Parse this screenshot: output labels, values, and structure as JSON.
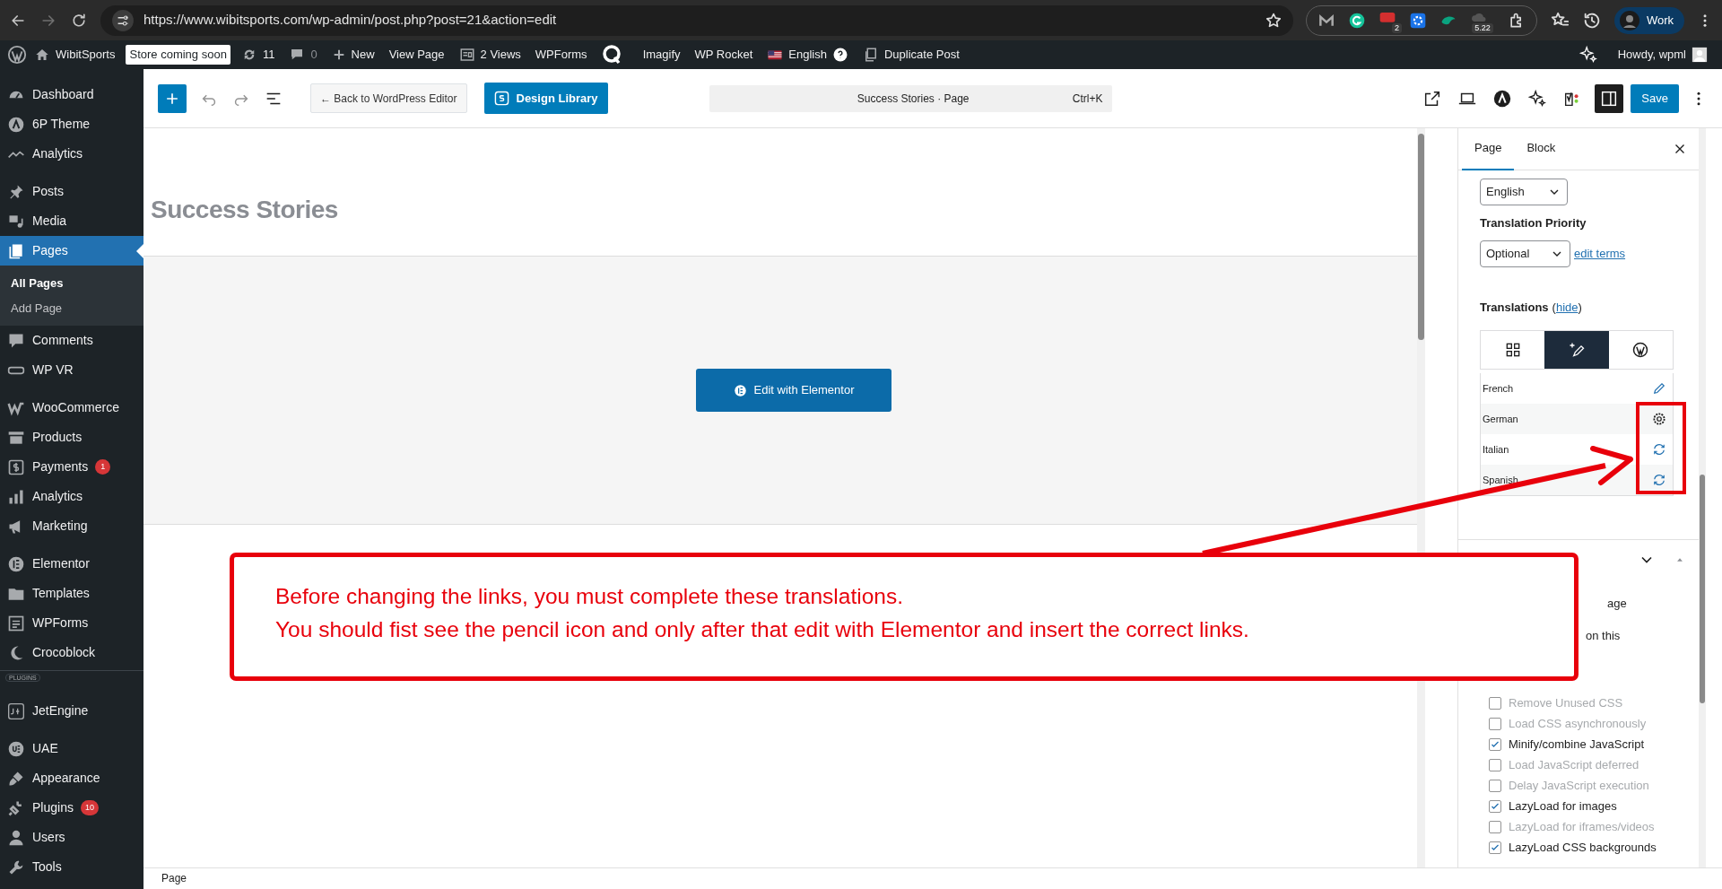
{
  "browser": {
    "url": "https://www.wibitsports.com/wp-admin/post.php?post=21&action=edit",
    "extension_badges": [
      "2",
      "5.22"
    ],
    "profile": "Work"
  },
  "admin_bar": {
    "items": [
      {
        "text": "WibitSports",
        "kind": "link"
      },
      {
        "text": "Store coming soon",
        "kind": "tag"
      },
      {
        "text": "11",
        "kind": "link"
      },
      {
        "text": "0",
        "kind": "dim"
      },
      {
        "text": "New",
        "kind": "link"
      },
      {
        "text": "View Page",
        "kind": "link"
      },
      {
        "text": "2 Views",
        "kind": "link"
      },
      {
        "text": "WPForms",
        "kind": "link"
      },
      {
        "text": "Imagify",
        "kind": "link"
      },
      {
        "text": "WP Rocket",
        "kind": "link"
      },
      {
        "text": "English",
        "kind": "link"
      },
      {
        "text": "Duplicate Post",
        "kind": "link"
      }
    ],
    "greeting": "Howdy, wpml"
  },
  "sidebar": {
    "groups": [
      {
        "items": [
          {
            "label": "Dashboard",
            "selected": false
          },
          {
            "label": "6P Theme",
            "selected": false
          },
          {
            "label": "Analytics",
            "selected": false
          }
        ]
      },
      {
        "items": [
          {
            "label": "Posts",
            "selected": false
          },
          {
            "label": "Media",
            "selected": false
          },
          {
            "label": "Pages",
            "selected": true,
            "children": [
              {
                "label": "All Pages",
                "selected": true
              },
              {
                "label": "Add Page",
                "selected": false
              }
            ]
          },
          {
            "label": "Comments",
            "selected": false
          },
          {
            "label": "WP VR",
            "selected": false
          }
        ]
      },
      {
        "items": [
          {
            "label": "WooCommerce",
            "selected": false
          },
          {
            "label": "Products",
            "selected": false
          },
          {
            "label": "Payments",
            "selected": false,
            "badge": "1"
          },
          {
            "label": "Analytics",
            "selected": false
          },
          {
            "label": "Marketing",
            "selected": false
          }
        ]
      },
      {
        "items": [
          {
            "label": "Elementor",
            "selected": false
          },
          {
            "label": "Templates",
            "selected": false
          },
          {
            "label": "WPForms",
            "selected": false
          },
          {
            "label": "Crocoblock",
            "selected": false
          }
        ]
      },
      {
        "section_label": "PLUGINS",
        "items": [
          {
            "label": "JetEngine",
            "selected": false
          }
        ]
      },
      {
        "items": [
          {
            "label": "UAE",
            "selected": false
          },
          {
            "label": "Appearance",
            "selected": false
          },
          {
            "label": "Plugins",
            "selected": false,
            "badge": "10"
          },
          {
            "label": "Users",
            "selected": false
          },
          {
            "label": "Tools",
            "selected": false
          }
        ]
      }
    ]
  },
  "toolbar": {
    "back_button": "← Back to WordPress Editor",
    "library_button": "Design Library",
    "command_title": "Success Stories · Page",
    "shortcut": "Ctrl+K",
    "save_button": "Save"
  },
  "canvas": {
    "title": "Success Stories",
    "elementor_button": "Edit with Elementor"
  },
  "panel": {
    "tabs": [
      {
        "label": "Page",
        "selected": true
      },
      {
        "label": "Block",
        "selected": false
      }
    ],
    "language": "English",
    "priority_label": "Translation Priority",
    "priority": "Optional",
    "edit_terms": "edit terms",
    "translations_label": "Translations",
    "paren_open": "(",
    "hide_link": "hide",
    "paren_close": ")",
    "view_tabs": [
      {
        "selected": false
      },
      {
        "selected": true
      },
      {
        "selected": false
      }
    ],
    "languages": [
      {
        "name": "French",
        "kind": "edit"
      },
      {
        "name": "German",
        "kind": "settings"
      },
      {
        "name": "Italian",
        "kind": "sync"
      },
      {
        "name": "Spanish",
        "kind": "sync"
      }
    ],
    "fragments": [
      "age",
      "on this"
    ],
    "options": [
      {
        "label": "Remove Unused CSS",
        "checked": false
      },
      {
        "label": "Load CSS asynchronously",
        "checked": false
      },
      {
        "label": "Minify/combine JavaScript",
        "checked": true
      },
      {
        "label": "Load JavaScript deferred",
        "checked": false
      },
      {
        "label": "Delay JavaScript execution",
        "checked": false
      },
      {
        "label": "LazyLoad for images",
        "checked": true
      },
      {
        "label": "LazyLoad for iframes/videos",
        "checked": false
      },
      {
        "label": "LazyLoad CSS backgrounds",
        "checked": true
      }
    ]
  },
  "status_bar": "Page",
  "annotation": {
    "lines": [
      "Before changing the links, you must complete these translations.",
      "You should fist see the pencil icon and only after that edit with Elementor and insert the correct links."
    ]
  }
}
